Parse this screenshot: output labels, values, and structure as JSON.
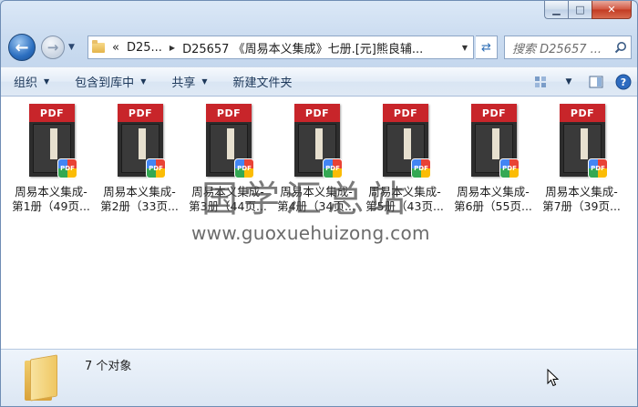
{
  "window": {
    "caption": {
      "minimize": "▁",
      "maximize": "□",
      "close": "✕"
    }
  },
  "nav": {
    "back_icon": "arrow-left",
    "forward_icon": "arrow-right"
  },
  "address": {
    "overflow": "«",
    "segments": [
      "D25...",
      "D25657 《周易本义集成》七册.[元]熊良辅..."
    ]
  },
  "search": {
    "placeholder": "搜索 D25657 ..."
  },
  "toolbar": {
    "organize": "组织",
    "include_in_library": "包含到库中",
    "share": "共享",
    "new_folder": "新建文件夹"
  },
  "files": [
    {
      "line1": "周易本义集成-",
      "line2": "第1册（49页...",
      "thumb_label": "PDF",
      "badge": "PDF"
    },
    {
      "line1": "周易本义集成-",
      "line2": "第2册（33页...",
      "thumb_label": "PDF",
      "badge": "PDF"
    },
    {
      "line1": "周易本义集成-",
      "line2": "第3册（44页...",
      "thumb_label": "PDF",
      "badge": "PDF"
    },
    {
      "line1": "周易本义集成-",
      "line2": "第4册（34页...",
      "thumb_label": "PDF",
      "badge": "PDF"
    },
    {
      "line1": "周易本义集成-",
      "line2": "第5册（43页...",
      "thumb_label": "PDF",
      "badge": "PDF"
    },
    {
      "line1": "周易本义集成-",
      "line2": "第6册（55页...",
      "thumb_label": "PDF",
      "badge": "PDF"
    },
    {
      "line1": "周易本义集成-",
      "line2": "第7册（39页...",
      "thumb_label": "PDF",
      "badge": "PDF"
    }
  ],
  "watermark": {
    "chinese": "国学汇总站",
    "url": "www.guoxuehuizong.com"
  },
  "status": {
    "count": "7 个对象"
  },
  "colors": {
    "pdf_red": "#c8252a",
    "window_blue": "#c3d6ed"
  }
}
